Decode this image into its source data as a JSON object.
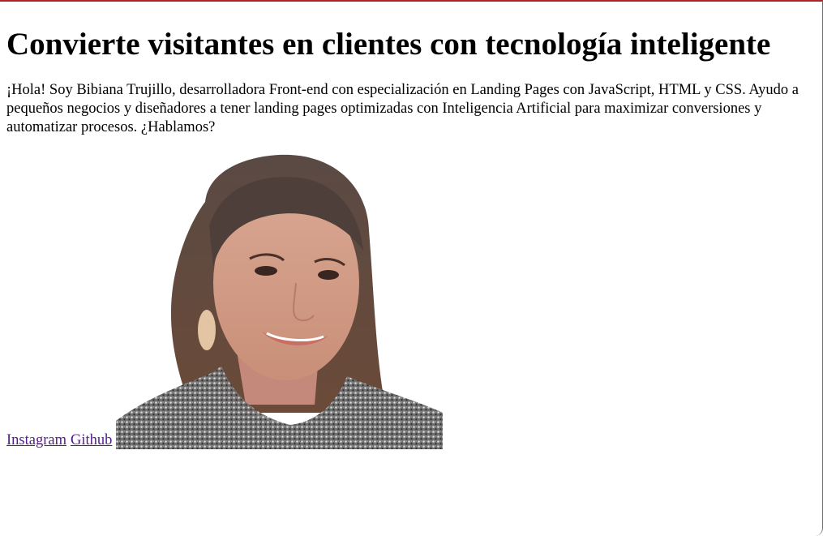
{
  "hero": {
    "title": "Convierte visitantes en clientes con tecnología inteligente",
    "intro": "¡Hola! Soy Bibiana Trujillo, desarrolladora Front-end con especialización en Landing Pages con JavaScript, HTML y CSS. Ayudo a pequeños negocios y diseñadores a tener landing pages optimizadas con Inteligencia Artificial para maximizar conversiones y automatizar procesos. ¿Hablamos?"
  },
  "links": [
    {
      "label": "Instagram"
    },
    {
      "label": "Github"
    }
  ],
  "colors": {
    "top_border": "#b22222",
    "link_visited": "#551a8b"
  }
}
